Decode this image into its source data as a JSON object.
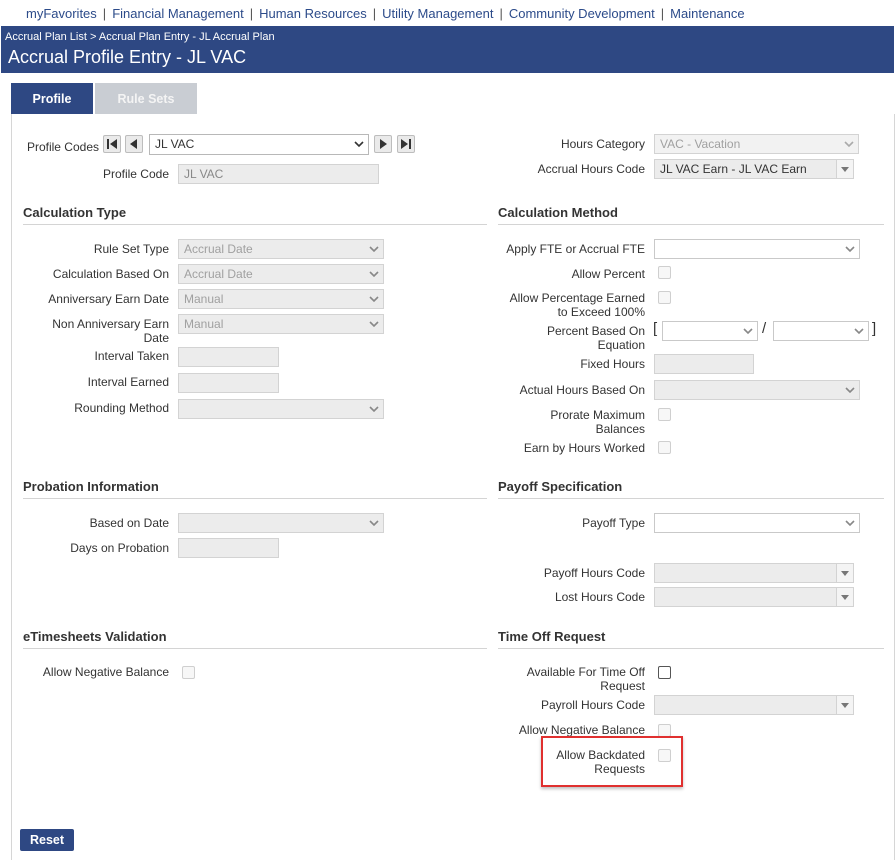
{
  "top_nav": [
    "myFavorites",
    "Financial Management",
    "Human Resources",
    "Utility Management",
    "Community Development",
    "Maintenance"
  ],
  "nav_separator": "|",
  "breadcrumb": [
    "Accrual Plan List",
    "Accrual Plan Entry - JL Accrual Plan"
  ],
  "breadcrumb_separator": ">",
  "page_title": "Accrual Profile Entry - JL VAC",
  "tabs": [
    {
      "label": "Profile",
      "active": true
    },
    {
      "label": "Rule Sets",
      "active": false
    }
  ],
  "profile": {
    "codes_label": "Profile Codes",
    "codes_value": "JL VAC",
    "code_label": "Profile Code",
    "code_value": "JL VAC",
    "hours_category_label": "Hours Category",
    "hours_category_value": "VAC - Vacation",
    "accrual_hours_code_label": "Accrual Hours Code",
    "accrual_hours_code_value": "JL VAC Earn - JL VAC Earn"
  },
  "calculation_type": {
    "title": "Calculation Type",
    "rule_set_type_label": "Rule Set Type",
    "rule_set_type_value": "Accrual Date",
    "calc_based_on_label": "Calculation Based On",
    "calc_based_on_value": "Accrual Date",
    "anniv_earn_date_label": "Anniversary Earn Date",
    "anniv_earn_date_value": "Manual",
    "non_anniv_label_1": "Non Anniversary Earn",
    "non_anniv_label_2": "Date",
    "non_anniv_value": "Manual",
    "interval_taken_label": "Interval Taken",
    "interval_earned_label": "Interval Earned",
    "rounding_method_label": "Rounding Method"
  },
  "calculation_method": {
    "title": "Calculation Method",
    "apply_fte_label": "Apply FTE or Accrual FTE",
    "allow_percent_label": "Allow Percent",
    "allow_pct_exceed_label_1": "Allow Percentage Earned",
    "allow_pct_exceed_label_2": "to Exceed 100%",
    "percent_based_label_1": "Percent Based On",
    "percent_based_label_2": "Equation",
    "bracket_open": "[",
    "slash": "/",
    "bracket_close": "]",
    "fixed_hours_label": "Fixed Hours",
    "actual_hours_based_label": "Actual Hours Based On",
    "prorate_max_label_1": "Prorate Maximum",
    "prorate_max_label_2": "Balances",
    "earn_by_hours_label": "Earn by Hours Worked"
  },
  "probation": {
    "title": "Probation Information",
    "based_on_date_label": "Based on Date",
    "days_on_probation_label": "Days on Probation"
  },
  "payoff": {
    "title": "Payoff Specification",
    "payoff_type_label": "Payoff Type",
    "payoff_hours_code_label": "Payoff Hours Code",
    "lost_hours_code_label": "Lost Hours Code"
  },
  "etimesheets": {
    "title": "eTimesheets Validation",
    "allow_negative_label": "Allow Negative Balance"
  },
  "time_off": {
    "title": "Time Off Request",
    "available_label_1": "Available For Time Off",
    "available_label_2": "Request",
    "payroll_hours_code_label": "Payroll Hours Code",
    "allow_negative_label": "Allow Negative Balance",
    "allow_backdated_label_1": "Allow Backdated",
    "allow_backdated_label_2": "Requests"
  },
  "reset_label": "Reset",
  "colors": {
    "brand_blue": "#2e4883",
    "highlight_red": "#e0302f"
  }
}
